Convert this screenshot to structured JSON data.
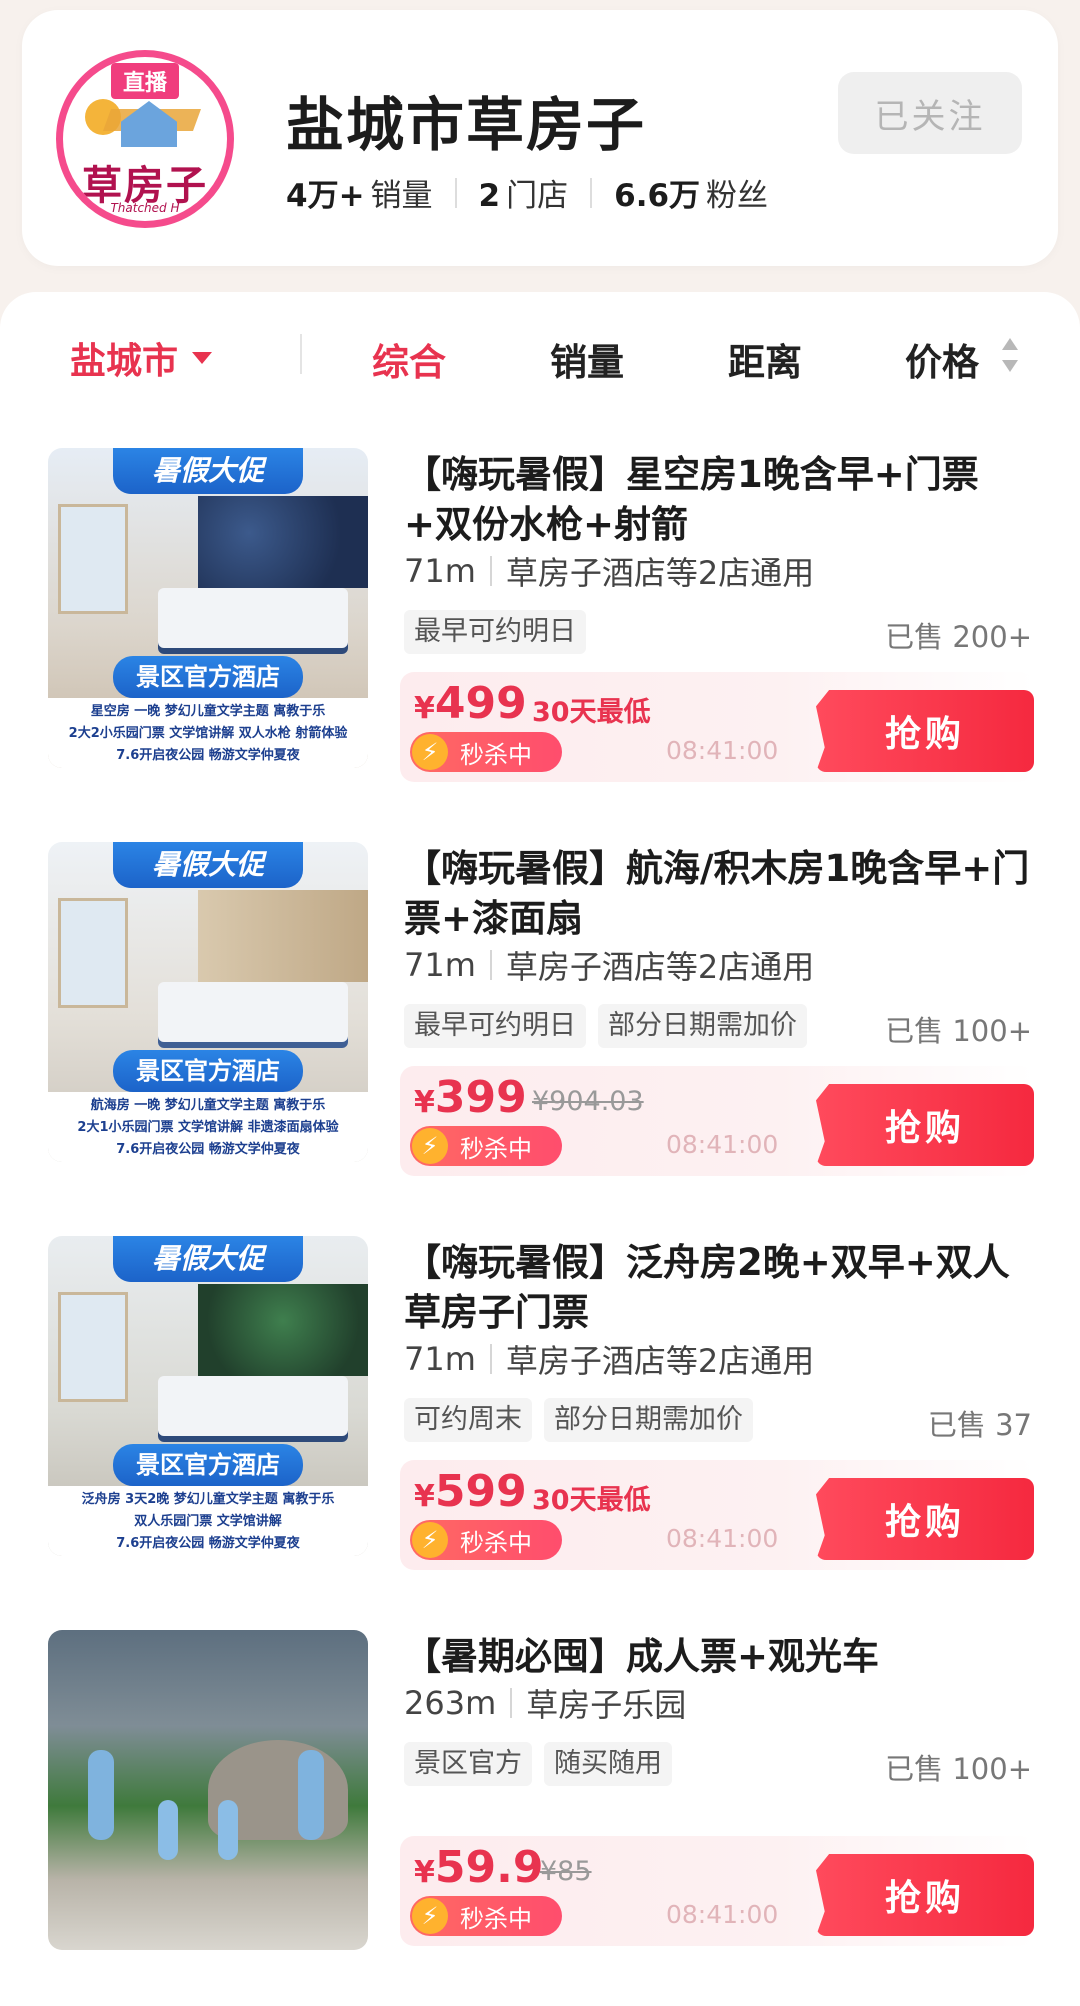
{
  "shop": {
    "logo_badge": "直播",
    "logo_text": "草房子",
    "logo_sub": "Thatched H",
    "name": "盐城市草房子",
    "stats": [
      {
        "value": "4万+",
        "label": "销量"
      },
      {
        "value": "2",
        "label": "门店"
      },
      {
        "value": "6.6万",
        "label": "粉丝"
      }
    ],
    "follow_label": "已关注"
  },
  "filters": {
    "city": "盐城市",
    "tabs": [
      "综合",
      "销量",
      "距离",
      "价格"
    ],
    "active_tab": "综合"
  },
  "colors": {
    "accent": "#e8334f",
    "thumb_blue": "#1c63c9"
  },
  "products": [
    {
      "thumb": {
        "badge_top": "暑假大促",
        "badge_mid": "景区官方酒店",
        "caption": [
          "星空房 一晚 梦幻儿童文学主题 寓教于乐",
          "2大2小乐园门票 文学馆讲解 双人水枪 射箭体验",
          "7.6开启夜公园 畅游文学仲夏夜"
        ]
      },
      "title": "【嗨玩暑假】星空房1晚含早+门票+双份水枪+射箭",
      "distance": "71m",
      "store": "草房子酒店等2店通用",
      "tags": [
        "最早可约明日"
      ],
      "sold": "已售 200+",
      "price_yen": "¥",
      "price": "499",
      "price_tag": "30天最低",
      "orig_price": "",
      "seckill": "秒杀中",
      "countdown": "08:41:00",
      "buy_label": "抢购"
    },
    {
      "thumb": {
        "badge_top": "暑假大促",
        "badge_mid": "景区官方酒店",
        "caption": [
          "航海房 一晚 梦幻儿童文学主题 寓教于乐",
          "2大1小乐园门票 文学馆讲解 非遗漆面扇体验",
          "7.6开启夜公园 畅游文学仲夏夜"
        ]
      },
      "title": "【嗨玩暑假】航海/积木房1晚含早+门票+漆面扇",
      "distance": "71m",
      "store": "草房子酒店等2店通用",
      "tags": [
        "最早可约明日",
        "部分日期需加价"
      ],
      "sold": "已售 100+",
      "price_yen": "¥",
      "price": "399",
      "price_tag": "",
      "orig_price": "¥904.03",
      "seckill": "秒杀中",
      "countdown": "08:41:00",
      "buy_label": "抢购"
    },
    {
      "thumb": {
        "badge_top": "暑假大促",
        "badge_mid": "景区官方酒店",
        "caption": [
          "泛舟房 3天2晚 梦幻儿童文学主题 寓教于乐",
          "双人乐园门票 文学馆讲解",
          "7.6开启夜公园 畅游文学仲夏夜"
        ]
      },
      "title": "【嗨玩暑假】泛舟房2晚+双早+双人草房子门票",
      "distance": "71m",
      "store": "草房子酒店等2店通用",
      "tags": [
        "可约周末",
        "部分日期需加价"
      ],
      "sold": "已售 37",
      "price_yen": "¥",
      "price": "599",
      "price_tag": "30天最低",
      "orig_price": "",
      "seckill": "秒杀中",
      "countdown": "08:41:00",
      "buy_label": "抢购"
    },
    {
      "thumb": {
        "badge_top": "",
        "badge_mid": "",
        "caption": []
      },
      "title": "【暑期必囤】成人票+观光车",
      "distance": "263m",
      "store": "草房子乐园",
      "tags": [
        "景区官方",
        "随买随用"
      ],
      "sold": "已售 100+",
      "price_yen": "¥",
      "price": "59.9",
      "price_tag": "",
      "orig_price": "¥85",
      "seckill": "秒杀中",
      "countdown": "08:41:00",
      "buy_label": "抢购"
    }
  ]
}
